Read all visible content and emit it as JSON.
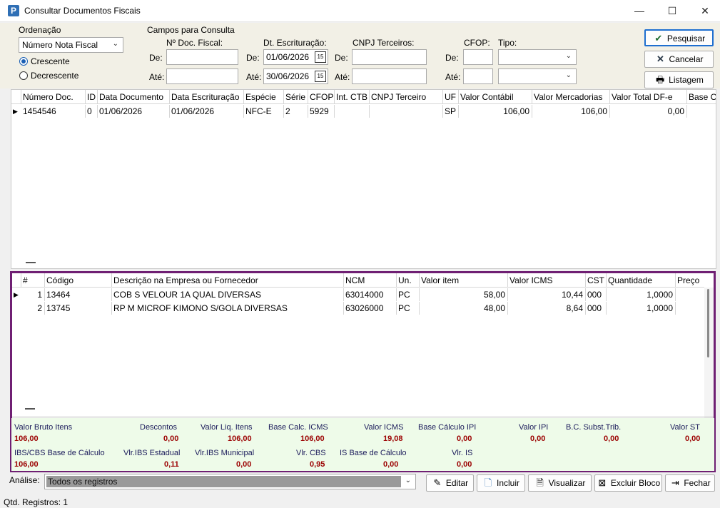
{
  "window": {
    "title": "Consultar Documentos Fiscais",
    "icon_letter": "P",
    "minimize": "—",
    "maximize": "☐",
    "close": "✕"
  },
  "ordering": {
    "title": "Ordenação",
    "selected": "Número Nota Fiscal",
    "asc": "Crescente",
    "desc": "Decrescente"
  },
  "query": {
    "title": "Campos para Consulta",
    "doc_label": "Nº Doc. Fiscal:",
    "dt_label": "Dt. Escrituração:",
    "cnpj_label": "CNPJ Terceiros:",
    "cfop_label": "CFOP:",
    "tipo_label": "Tipo:",
    "de": "De:",
    "ate": "Até:",
    "dt_from": "01/06/2026",
    "dt_to": "30/06/2026",
    "cal_icon": "15"
  },
  "buttons": {
    "pesquisar": "Pesquisar",
    "cancelar": "Cancelar",
    "listagem": "Listagem",
    "editar": "Editar",
    "incluir": "Incluir",
    "visualizar": "Visualizar",
    "excluir": "Excluir Bloco",
    "fechar": "Fechar"
  },
  "docs_grid": {
    "headers": [
      "Número Doc.",
      "ID",
      "Data Documento",
      "Data Escrituração",
      "Espécie",
      "Série",
      "CFOP",
      "Int. CTB",
      "CNPJ Terceiro",
      "UF",
      "Valor Contábil",
      "Valor Mercadorias",
      "Valor Total DF-e",
      "Base C"
    ],
    "rows": [
      {
        "numero": "1454546",
        "id": "0",
        "data_doc": "01/06/2026",
        "data_esc": "01/06/2026",
        "especie": "NFC-E",
        "serie": "2",
        "cfop": "5929",
        "int_ctb": "",
        "cnpj": "",
        "uf": "SP",
        "valor_contabil": "106,00",
        "valor_merc": "106,00",
        "valor_total": "0,00"
      }
    ]
  },
  "items_grid": {
    "headers": [
      "#",
      "Código",
      "Descrição na Empresa ou Fornecedor",
      "NCM",
      "Un.",
      "Valor item",
      "Valor ICMS",
      "CST",
      "Quantidade",
      "Preço"
    ],
    "rows": [
      {
        "n": "1",
        "codigo": "13464",
        "descricao": "COB S VELOUR 1A QUAL DIVERSAS",
        "ncm": "63014000",
        "un": "PC",
        "valor_item": "58,00",
        "valor_icms": "10,44",
        "cst": "000",
        "qtd": "1,0000"
      },
      {
        "n": "2",
        "codigo": "13745",
        "descricao": "RP M MICROF KIMONO S/GOLA DIVERSAS",
        "ncm": "63026000",
        "un": "PC",
        "valor_item": "48,00",
        "valor_icms": "8,64",
        "cst": "000",
        "qtd": "1,0000"
      }
    ]
  },
  "totals": {
    "row1": [
      {
        "label": "Valor Bruto Itens",
        "value": "106,00"
      },
      {
        "label": "Descontos",
        "value": "0,00"
      },
      {
        "label": "Valor Liq. Itens",
        "value": "106,00"
      },
      {
        "label": "Base Calc. ICMS",
        "value": "106,00"
      },
      {
        "label": "Valor ICMS",
        "value": "19,08"
      },
      {
        "label": "Base Cálculo IPI",
        "value": "0,00"
      },
      {
        "label": "Valor IPI",
        "value": "0,00"
      },
      {
        "label": "B.C. Subst.Trib.",
        "value": "0,00"
      },
      {
        "label": "Valor ST",
        "value": "0,00"
      }
    ],
    "row2": [
      {
        "label": "IBS/CBS Base de Cálculo",
        "value": "106,00"
      },
      {
        "label": "Vlr.IBS Estadual",
        "value": "0,11"
      },
      {
        "label": "Vlr.IBS Municipal",
        "value": "0,00"
      },
      {
        "label": "Vlr. CBS",
        "value": "0,95"
      },
      {
        "label": "IS Base de Cálculo",
        "value": "0,00"
      },
      {
        "label": "Vlr. IS",
        "value": "0,00"
      }
    ]
  },
  "analise": {
    "label": "Análise:",
    "value": "Todos os registros"
  },
  "status": {
    "text": "Qtd. Registros: 1"
  }
}
